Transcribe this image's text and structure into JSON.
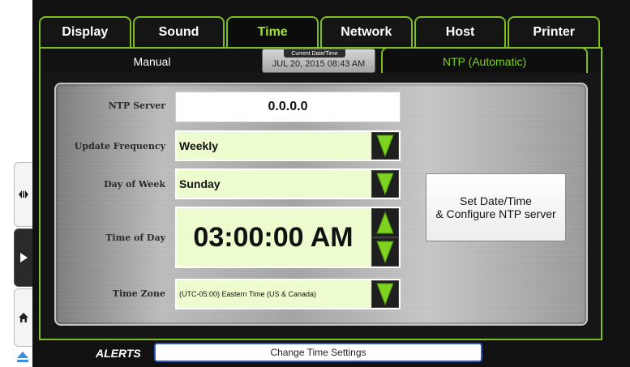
{
  "tabs": [
    "Display",
    "Sound",
    "Time",
    "Network",
    "Host",
    "Printer"
  ],
  "active_tab": "Time",
  "subtabs": {
    "manual": "Manual",
    "ntp": "NTP (Automatic)"
  },
  "current_datetime": {
    "caption": "Current Date/Time",
    "value": "JUL 20, 2015 08:43 AM"
  },
  "form": {
    "ntp_server": {
      "label": "NTP Server",
      "value": "0.0.0.0"
    },
    "update_frequency": {
      "label": "Update Frequency",
      "value": "Weekly"
    },
    "day_of_week": {
      "label": "Day of Week",
      "value": "Sunday"
    },
    "time_of_day": {
      "label": "Time of Day",
      "value": "03:00:00 AM"
    },
    "time_zone": {
      "label": "Time Zone",
      "value": "(UTC-05:00) Eastern Time (US & Canada)"
    }
  },
  "set_button": {
    "line1": "Set Date/Time",
    "line2": "& Configure NTP server"
  },
  "alerts": {
    "label": "ALERTS",
    "message": "Change Time Settings"
  },
  "colors": {
    "accent_green": "#7cbf1f",
    "field_bg": "#ecfccf",
    "alert_border": "#2f57b8"
  }
}
